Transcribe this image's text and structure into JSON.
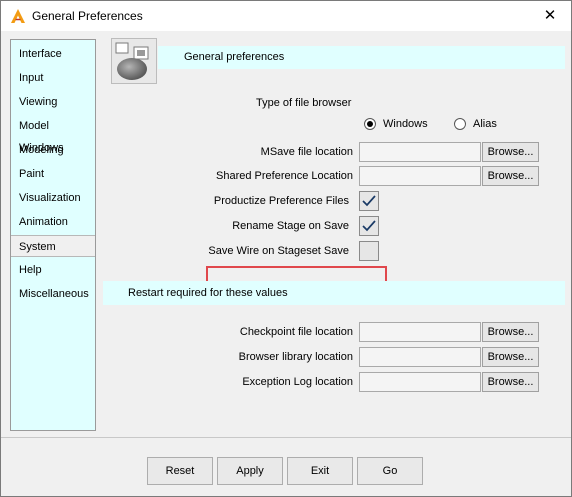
{
  "window": {
    "title": "General Preferences",
    "close_symbol": "✕"
  },
  "sidebar": {
    "items": [
      {
        "label": "Interface"
      },
      {
        "label": "Input"
      },
      {
        "label": "Viewing"
      },
      {
        "label": "Model Windows"
      },
      {
        "label": "Modeling"
      },
      {
        "label": "Paint"
      },
      {
        "label": "Visualization"
      },
      {
        "label": "Animation"
      },
      {
        "label": "System",
        "selected": true
      },
      {
        "label": "Help"
      },
      {
        "label": "Miscellaneous"
      }
    ]
  },
  "header": {
    "title": "General preferences",
    "icon": "preferences-icon"
  },
  "file_browser": {
    "label": "Type of file browser",
    "options": [
      {
        "label": "Windows",
        "selected": true
      },
      {
        "label": "Alias",
        "selected": false
      }
    ]
  },
  "fields": {
    "msave": {
      "label": "MSave file location",
      "value": "",
      "browse": "Browse..."
    },
    "shared": {
      "label": "Shared Preference Location",
      "value": "",
      "browse": "Browse..."
    },
    "checkpoint": {
      "label": "Checkpoint file location",
      "value": "",
      "browse": "Browse..."
    },
    "browser_lib": {
      "label": "Browser library location",
      "value": "",
      "browse": "Browse..."
    },
    "exception_log": {
      "label": "Exception Log location",
      "value": "",
      "browse": "Browse..."
    }
  },
  "checks": {
    "productize": {
      "label": "Productize Preference Files",
      "checked": true
    },
    "rename": {
      "label": "Rename Stage on Save",
      "checked": true
    },
    "savewire": {
      "label": "Save Wire on Stageset Save",
      "checked": false
    }
  },
  "restart": {
    "text": "Restart required for these values"
  },
  "footer": {
    "reset": "Reset",
    "apply": "Apply",
    "exit": "Exit",
    "go": "Go"
  },
  "colors": {
    "panel_accent": "#e0ffff",
    "highlight": "#e0474c",
    "app_icon": "#f39c12"
  }
}
